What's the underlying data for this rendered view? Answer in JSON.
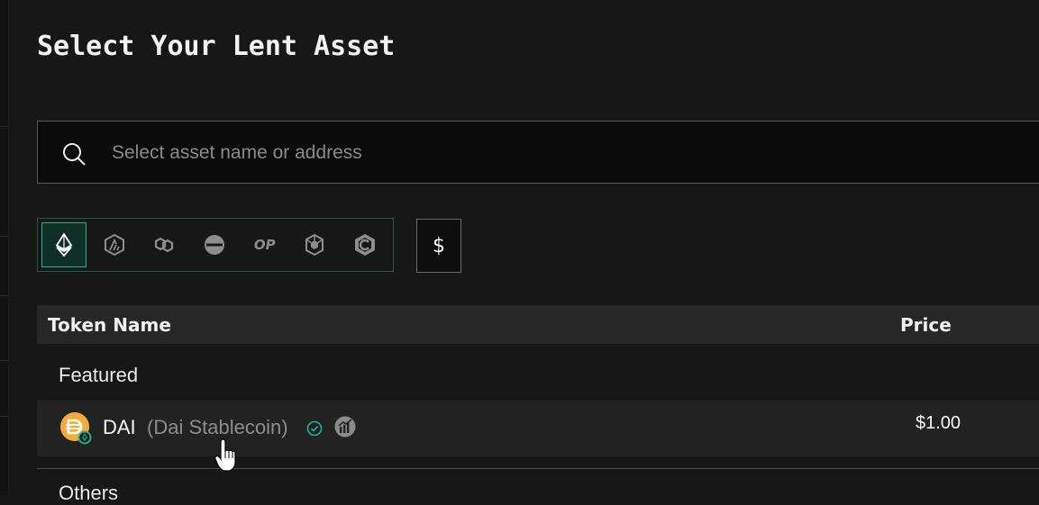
{
  "title": "Select Your Lent Asset",
  "search": {
    "placeholder": "Select asset name or address"
  },
  "chains": [
    {
      "name": "ethereum",
      "icon": "ethereum-icon",
      "active": true
    },
    {
      "name": "arbitrum",
      "icon": "arbitrum-icon",
      "active": false
    },
    {
      "name": "polygon",
      "icon": "polygon-icon",
      "active": false
    },
    {
      "name": "linea",
      "icon": "linea-icon",
      "active": false
    },
    {
      "name": "optimism",
      "icon": "optimism-icon",
      "label": "OP",
      "active": false
    },
    {
      "name": "bnb-chain",
      "icon": "bnb-chain-icon",
      "active": false
    },
    {
      "name": "celo",
      "icon": "celo-icon",
      "active": false
    }
  ],
  "filter": {
    "dollar_label": "$"
  },
  "table": {
    "headers": {
      "token_name": "Token Name",
      "price": "Price"
    },
    "sections": {
      "featured": "Featured",
      "others": "Others"
    },
    "rows": [
      {
        "symbol": "DAI",
        "name": "(Dai Stablecoin)",
        "price": "$1.00",
        "verified": true
      }
    ]
  },
  "colors": {
    "accent": "#1fb392",
    "dai": "#f5ac37",
    "background": "#171717"
  }
}
